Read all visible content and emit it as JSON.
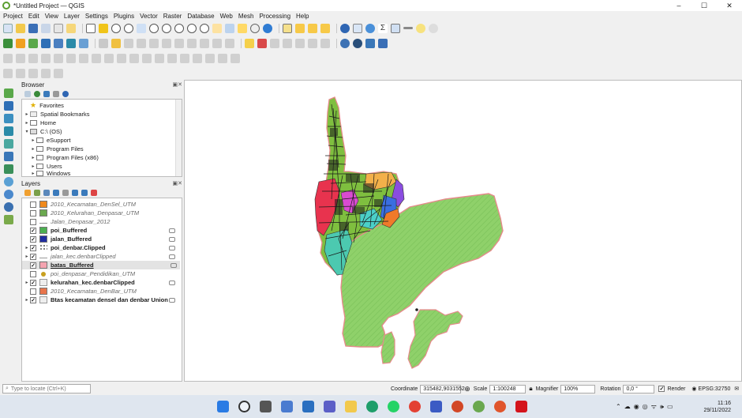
{
  "window": {
    "title": "*Untitled Project — QGIS"
  },
  "menu": [
    "Project",
    "Edit",
    "View",
    "Layer",
    "Settings",
    "Plugins",
    "Vector",
    "Raster",
    "Database",
    "Web",
    "Mesh",
    "Processing",
    "Help"
  ],
  "browser": {
    "title": "Browser",
    "items": [
      {
        "label": "Favorites",
        "icon": "star-icon"
      },
      {
        "label": "Spatial Bookmarks",
        "icon": "bookmark-icon"
      },
      {
        "label": "Home",
        "icon": "home-icon"
      },
      {
        "label": "C:\\ (OS)",
        "icon": "drive-icon"
      },
      {
        "label": "eSupport",
        "icon": "folder-icon"
      },
      {
        "label": "Program Files",
        "icon": "folder-icon"
      },
      {
        "label": "Program Files (x86)",
        "icon": "folder-icon"
      },
      {
        "label": "Users",
        "icon": "folder-icon"
      },
      {
        "label": "Windows",
        "icon": "folder-icon"
      }
    ]
  },
  "layers": {
    "title": "Layers",
    "items": [
      {
        "label": "2010_Kecamatan_DenSel_UTM",
        "checked": false,
        "style": "italic",
        "swatch": "#f08a1e"
      },
      {
        "label": "2010_Kelurahan_Denpasar_UTM",
        "checked": false,
        "style": "italic",
        "swatch": "#6aa84f"
      },
      {
        "label": "Jalan_Denpasar_2012",
        "checked": false,
        "style": "italic",
        "swatch": "line"
      },
      {
        "label": "poi_Buffered",
        "checked": true,
        "style": "bold",
        "swatch": "#4caf50"
      },
      {
        "label": "jalan_Buffered",
        "checked": true,
        "style": "bold",
        "swatch": "#1f2ca0"
      },
      {
        "label": "poi_denbar.Clipped",
        "checked": true,
        "style": "bold",
        "swatch": "points"
      },
      {
        "label": "jalan_kec.denbarClipped",
        "checked": true,
        "style": "italic",
        "swatch": "line"
      },
      {
        "label": "batas_Buffered",
        "checked": true,
        "style": "bold",
        "swatch": "#f4a3b0"
      },
      {
        "label": "poi_denpasar_Pendidikan_UTM",
        "checked": false,
        "style": "italic",
        "swatch": "point"
      },
      {
        "label": "kelurahan_kec.denbarClipped",
        "checked": true,
        "style": "bold",
        "swatch": "group"
      },
      {
        "label": "2010_Kecamatan_DenBar_UTM",
        "checked": false,
        "style": "italic",
        "swatch": "#e8744b"
      },
      {
        "label": "Btas kecamatan densel dan denbar Union",
        "checked": true,
        "style": "bold",
        "swatch": "group"
      }
    ]
  },
  "status": {
    "locate_placeholder": "Type to locate (Ctrl+K)",
    "coordinate_label": "Coordinate",
    "coordinate": "315482,9031552",
    "scale_label": "Scale",
    "scale": "1:100248",
    "magnifier_label": "Magnifier",
    "magnifier": "100%",
    "rotation_label": "Rotation",
    "rotation": "0,0 °",
    "render_label": "Render",
    "crs": "EPSG:32750"
  },
  "taskbar": {
    "time": "11:16",
    "date": "29/11/2022"
  },
  "colors": {
    "south_fill": "#8fd16a",
    "boundary": "#e58b8b",
    "north_fill": "#7fbf3f"
  }
}
